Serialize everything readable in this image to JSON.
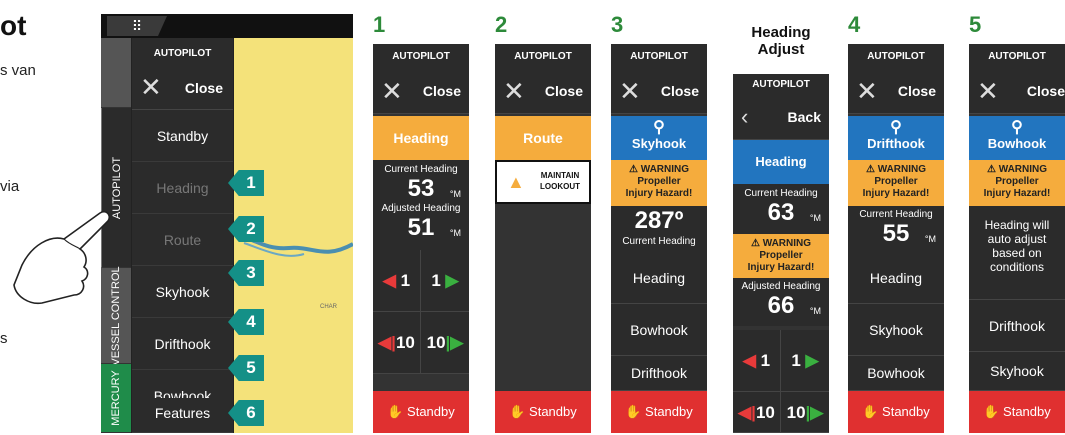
{
  "intro": {
    "title": "ot",
    "text": "s van",
    "via": "via",
    "s": "s"
  },
  "device": {
    "grid_icon": "⠿",
    "menu_title": "AUTOPILOT",
    "close_label": "Close",
    "tabs": [
      "AUTOPILOT",
      "VESSEL CONTROL",
      "MERCURY"
    ],
    "items": [
      {
        "label": "Standby",
        "dim": false,
        "callout": ""
      },
      {
        "label": "Heading",
        "dim": true,
        "callout": "1"
      },
      {
        "label": "Route",
        "dim": true,
        "callout": "2"
      },
      {
        "label": "Skyhook",
        "dim": false,
        "callout": "3"
      },
      {
        "label": "Drifthook",
        "dim": false,
        "callout": "4"
      },
      {
        "label": "Bowhook",
        "dim": false,
        "callout": "5"
      },
      {
        "label": "Features",
        "dim": false,
        "callout": "6"
      }
    ],
    "map_label": "CHAR"
  },
  "panels": {
    "p1": {
      "step": "1",
      "title": "AUTOPILOT",
      "close": "Close",
      "mode": "Heading",
      "current_label": "Current Heading",
      "current_value": "53",
      "unit": "°M",
      "adjusted_label": "Adjusted Heading",
      "adjusted_value": "51",
      "adj1_left": "1",
      "adj1_right": "1",
      "adj10_left": "10",
      "adj10_right": "10",
      "standby": "Standby"
    },
    "p2": {
      "step": "2",
      "title": "AUTOPILOT",
      "close": "Close",
      "mode": "Route",
      "lookout": "MAINTAIN LOOKOUT",
      "standby": "Standby"
    },
    "p3": {
      "step": "3",
      "title": "AUTOPILOT",
      "close": "Close",
      "mode": "Skyhook",
      "warning": "WARNING",
      "warning_text": "Propeller Injury Hazard!",
      "heading_value": "287º",
      "heading_label": "Current Heading",
      "options": [
        "Heading",
        "Bowhook",
        "Drifthook"
      ],
      "standby": "Standby"
    },
    "ha": {
      "caption": "Heading Adjust",
      "title": "AUTOPILOT",
      "back": "Back",
      "mode": "Heading",
      "current_label": "Current Heading",
      "current_value": "63",
      "unit": "°M",
      "warning": "WARNING",
      "warning_text": "Propeller Injury Hazard!",
      "adjusted_label": "Adjusted Heading",
      "adjusted_value": "66",
      "adj1_left": "1",
      "adj1_right": "1",
      "adj10_left": "10",
      "adj10_right": "10"
    },
    "p4": {
      "step": "4",
      "title": "AUTOPILOT",
      "close": "Close",
      "mode": "Drifthook",
      "warning": "WARNING",
      "warning_text": "Propeller Injury Hazard!",
      "current_label": "Current Heading",
      "current_value": "55",
      "unit": "°M",
      "options": [
        "Heading",
        "Skyhook",
        "Bowhook"
      ],
      "standby": "Standby"
    },
    "p5": {
      "step": "5",
      "title": "AUTOPILOT",
      "close": "Close",
      "mode": "Bowhook",
      "warning": "WARNING",
      "warning_text": "Propeller Injury Hazard!",
      "info": "Heading will auto adjust based on conditions",
      "options": [
        "Drifthook",
        "Skyhook"
      ],
      "standby": "Standby"
    }
  },
  "colors": {
    "accent_green": "#2d8a3a",
    "orange": "#f5ac3d",
    "blue": "#2275bf",
    "red": "#e03030",
    "teal": "#149087"
  }
}
